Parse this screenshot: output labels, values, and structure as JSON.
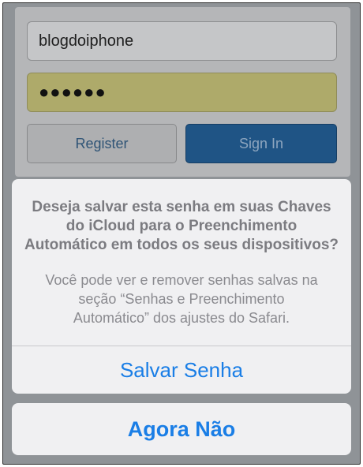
{
  "login": {
    "username_value": "blogdoiphone",
    "password_masked": "●●●●●●",
    "register_label": "Register",
    "signin_label": "Sign In"
  },
  "sheet": {
    "title_line1": "Deseja salvar esta senha em suas Chaves",
    "title_line2": "do iCloud para o Preenchimento",
    "title_line3": "Automático em todos os seus dispositivos?",
    "body_line1": "Você pode ver e remover senhas salvas na",
    "body_line2": "seção “Senhas e Preenchimento",
    "body_line3": "Automático” dos ajustes do Safari.",
    "save_label": "Salvar Senha",
    "cancel_label": "Agora Não"
  },
  "colors": {
    "action_blue": "#1a7ee6",
    "signin_blue": "#1f5485",
    "autofill_yellow": "#aeaa6a"
  }
}
